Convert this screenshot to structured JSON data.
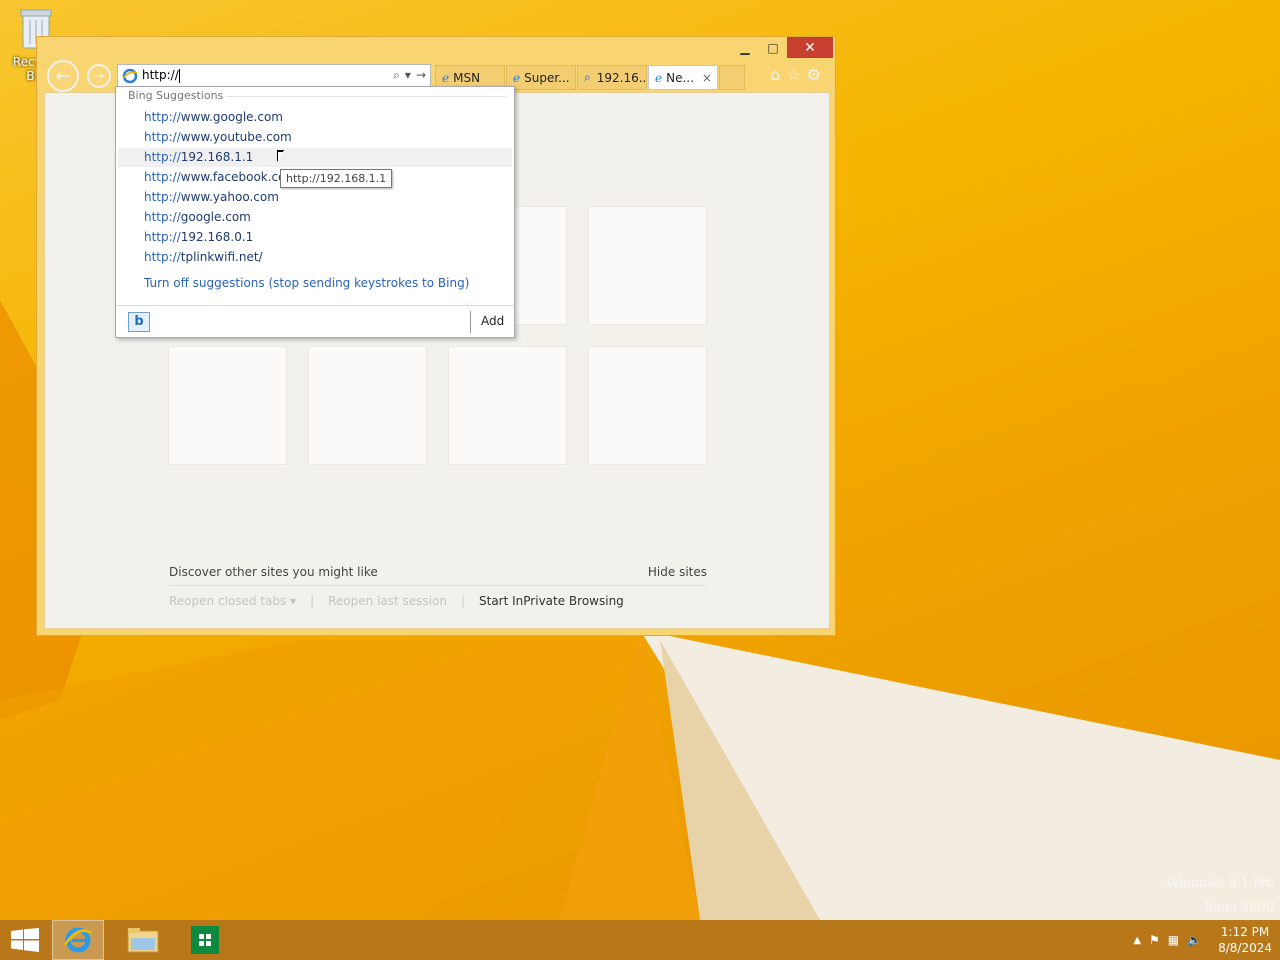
{
  "desktop": {
    "recycle_bin_label": "Recycle Bin",
    "watermark_line1": "Windows 8.1 Pro",
    "watermark_line2": "Build 9600"
  },
  "browser": {
    "address_value": "http://",
    "tabs": [
      {
        "label": "MSN",
        "icon": "ie-icon"
      },
      {
        "label": "Super...",
        "icon": "ie-icon"
      },
      {
        "label": "192.16...",
        "icon": "search-icon"
      },
      {
        "label": "Ne...",
        "icon": "ie-icon",
        "active": true
      }
    ],
    "tab_close": "×"
  },
  "suggestions": {
    "header": "Bing Suggestions",
    "items": [
      {
        "proto": "http://",
        "rest": "www.google.com"
      },
      {
        "proto": "http://",
        "rest": "www.youtube.com"
      },
      {
        "proto": "http://",
        "rest": "192.168.1.1"
      },
      {
        "proto": "http://",
        "rest": "www.facebook.com"
      },
      {
        "proto": "http://",
        "rest": "www.yahoo.com"
      },
      {
        "proto": "http://",
        "rest": "google.com"
      },
      {
        "proto": "http://",
        "rest": "192.168.0.1"
      },
      {
        "proto": "http://",
        "rest": "tplinkwifi.net/"
      }
    ],
    "turn_off": "Turn off suggestions (stop sending keystrokes to Bing)",
    "add_label": "Add",
    "tooltip": "http://192.168.1.1"
  },
  "newtab": {
    "discover": "Discover other sites you might like",
    "hide_sites": "Hide sites",
    "reopen_closed": "Reopen closed tabs",
    "reopen_last": "Reopen last session",
    "inprivate": "Start InPrivate Browsing"
  },
  "taskbar": {
    "time": "1:12 PM",
    "date": "8/8/2024"
  },
  "colors": {
    "accent": "#f6b100",
    "link": "#2a62b8",
    "close": "#c7402f"
  }
}
